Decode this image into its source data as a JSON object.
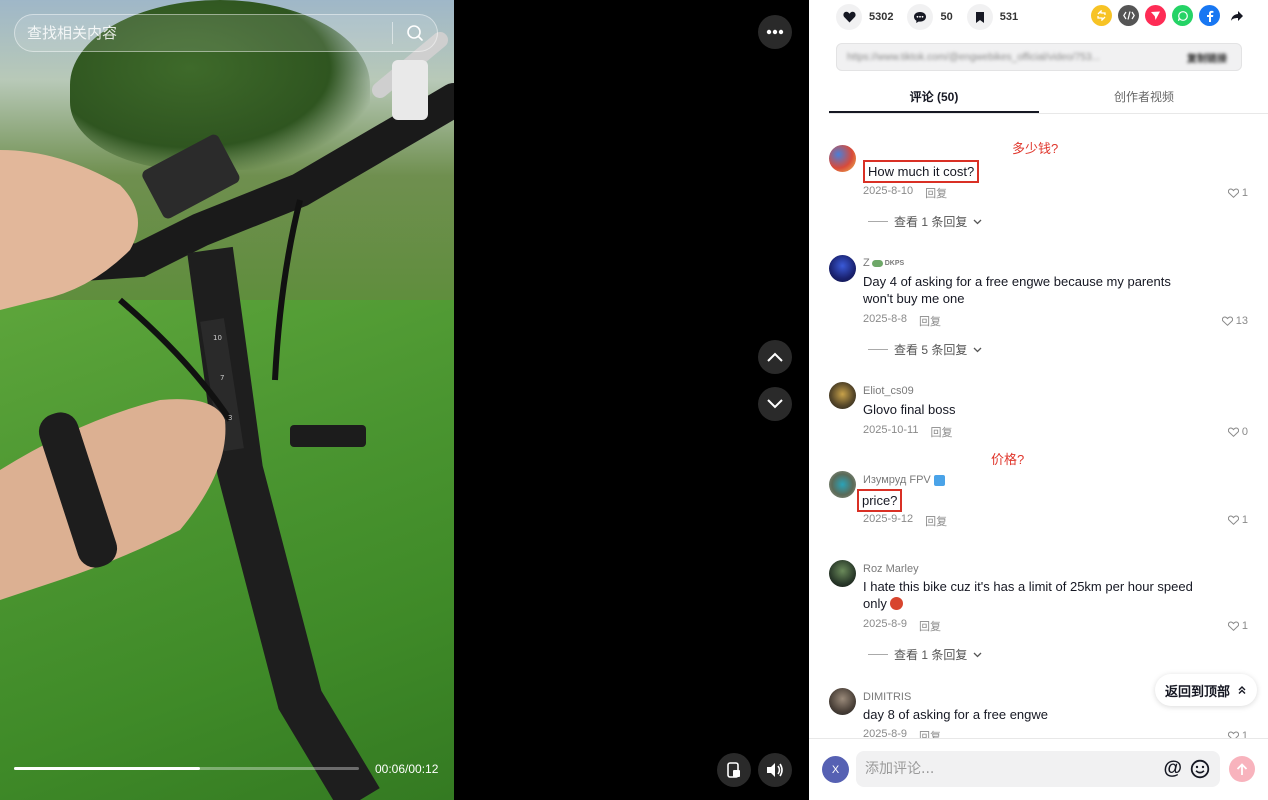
{
  "search": {
    "placeholder": "查找相关内容"
  },
  "player": {
    "time": "00:06/00:12",
    "progress": 0.54
  },
  "stats": {
    "likes": "5302",
    "comments": "50",
    "favorites": "531"
  },
  "url": {
    "text": "https://www.tiktok.com/@engwebikes_official/video/753...",
    "copy": "复制链接"
  },
  "tabs": [
    {
      "label": "评论 (50)"
    },
    {
      "label": "创作者视频"
    }
  ],
  "annotations": {
    "a1": "多少钱?",
    "a2": "价格?"
  },
  "comments": [
    {
      "user": "",
      "text": "How much it cost?",
      "date": "2025-8-10",
      "reply": "回复",
      "likes": "1",
      "view_replies": "查看 1 条回复"
    },
    {
      "user": "Z",
      "user_badge": "DKPS",
      "text": "Day 4 of asking for a free engwe because my parents won't buy me one",
      "date": "2025-8-8",
      "reply": "回复",
      "likes": "13",
      "view_replies": "查看 5 条回复"
    },
    {
      "user": "Eliot_cs09",
      "text": "Glovo final boss",
      "date": "2025-10-11",
      "reply": "回复",
      "likes": "0"
    },
    {
      "user": "Изумруд FPV",
      "text": "price?",
      "date": "2025-9-12",
      "reply": "回复",
      "likes": "1"
    },
    {
      "user": "Roz Marley",
      "text": "I hate this bike cuz it's has a limit of 25km per hour speed only",
      "date": "2025-8-9",
      "reply": "回复",
      "likes": "1",
      "view_replies": "查看 1 条回复"
    },
    {
      "user": "DIMITRIS",
      "text": "day 8 of asking for a free engwe",
      "date": "2025-8-9",
      "reply": "回复",
      "likes": "1"
    }
  ],
  "back_to_top": "返回到顶部",
  "composer": {
    "avatar_letter": "X",
    "placeholder": "添加评论...",
    "at": "@"
  },
  "colors": {
    "accent": "#fe2c55",
    "annotation": "#e0362c",
    "send_disabled": "#f8b3bd"
  }
}
